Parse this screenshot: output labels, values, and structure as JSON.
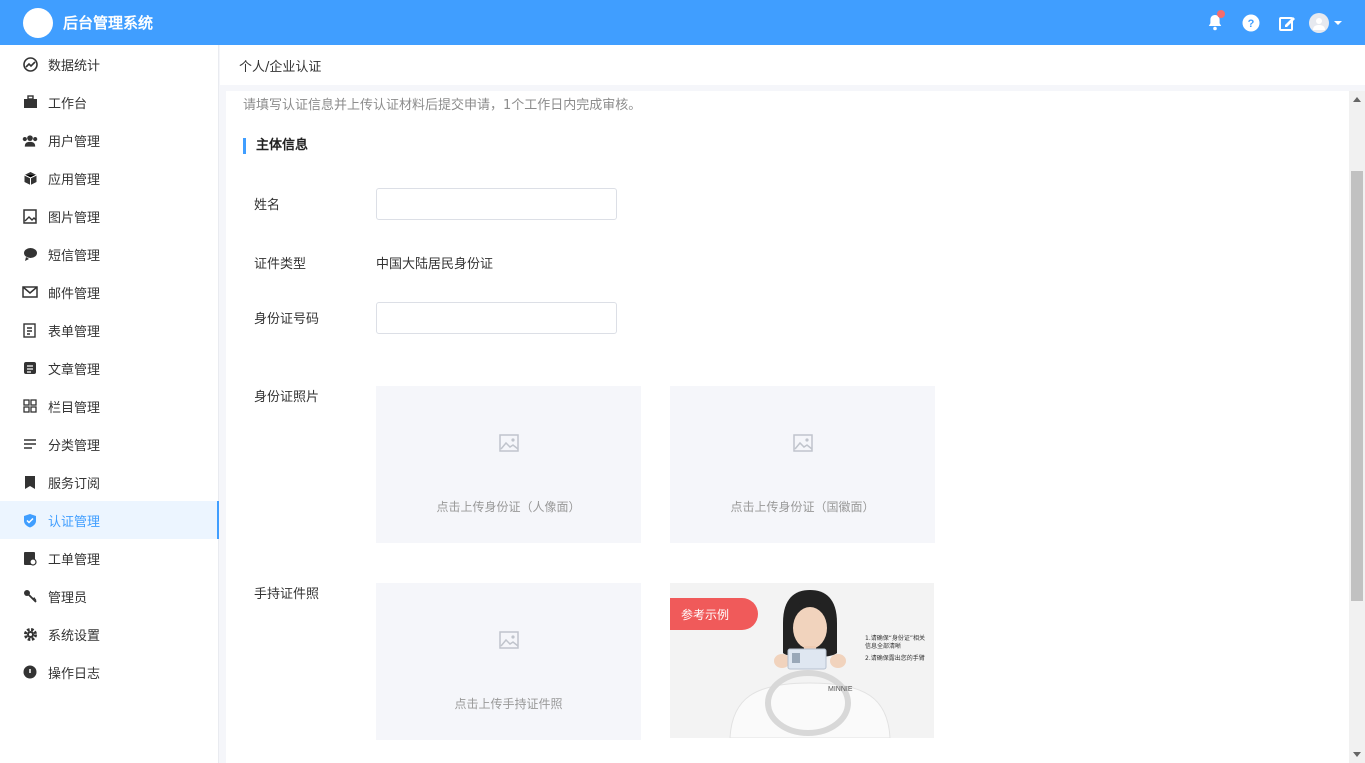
{
  "header": {
    "app_title": "后台管理系统",
    "brand_color": "#409eff",
    "actions": [
      "bell-icon",
      "help-icon",
      "edit-icon",
      "avatar"
    ]
  },
  "sidebar": {
    "items": [
      {
        "label": "数据统计",
        "icon": "dashboard-icon"
      },
      {
        "label": "工作台",
        "icon": "briefcase-icon"
      },
      {
        "label": "用户管理",
        "icon": "users-icon"
      },
      {
        "label": "应用管理",
        "icon": "cube-icon"
      },
      {
        "label": "图片管理",
        "icon": "image-icon"
      },
      {
        "label": "短信管理",
        "icon": "chat-icon"
      },
      {
        "label": "邮件管理",
        "icon": "mail-icon"
      },
      {
        "label": "表单管理",
        "icon": "form-icon"
      },
      {
        "label": "文章管理",
        "icon": "article-icon"
      },
      {
        "label": "栏目管理",
        "icon": "grid-icon"
      },
      {
        "label": "分类管理",
        "icon": "list-icon"
      },
      {
        "label": "服务订阅",
        "icon": "bookmark-icon"
      },
      {
        "label": "认证管理",
        "icon": "shield-icon",
        "active": true
      },
      {
        "label": "工单管理",
        "icon": "ticket-icon"
      },
      {
        "label": "管理员",
        "icon": "key-icon"
      },
      {
        "label": "系统设置",
        "icon": "gear-icon"
      },
      {
        "label": "操作日志",
        "icon": "log-icon"
      }
    ]
  },
  "breadcrumb": "个人/企业认证",
  "main": {
    "tip": "请填写认证信息并上传认证材料后提交申请，1个工作日内完成审核。",
    "section_title": "主体信息",
    "fields": {
      "name_label": "姓名",
      "name_value": "",
      "id_type_label": "证件类型",
      "id_type_value": "中国大陆居民身份证",
      "id_number_label": "身份证号码",
      "id_number_value": "",
      "id_photo_label": "身份证照片",
      "handheld_label": "手持证件照"
    },
    "uploads": {
      "front": "点击上传身份证（人像面）",
      "back": "点击上传身份证（国徽面）",
      "handheld": "点击上传手持证件照"
    },
    "sample": {
      "tag": "参考示例",
      "note1": "1.请确保“身份证”相关信息全部清晰",
      "note2": "2.请确保露出您的手臂"
    }
  }
}
